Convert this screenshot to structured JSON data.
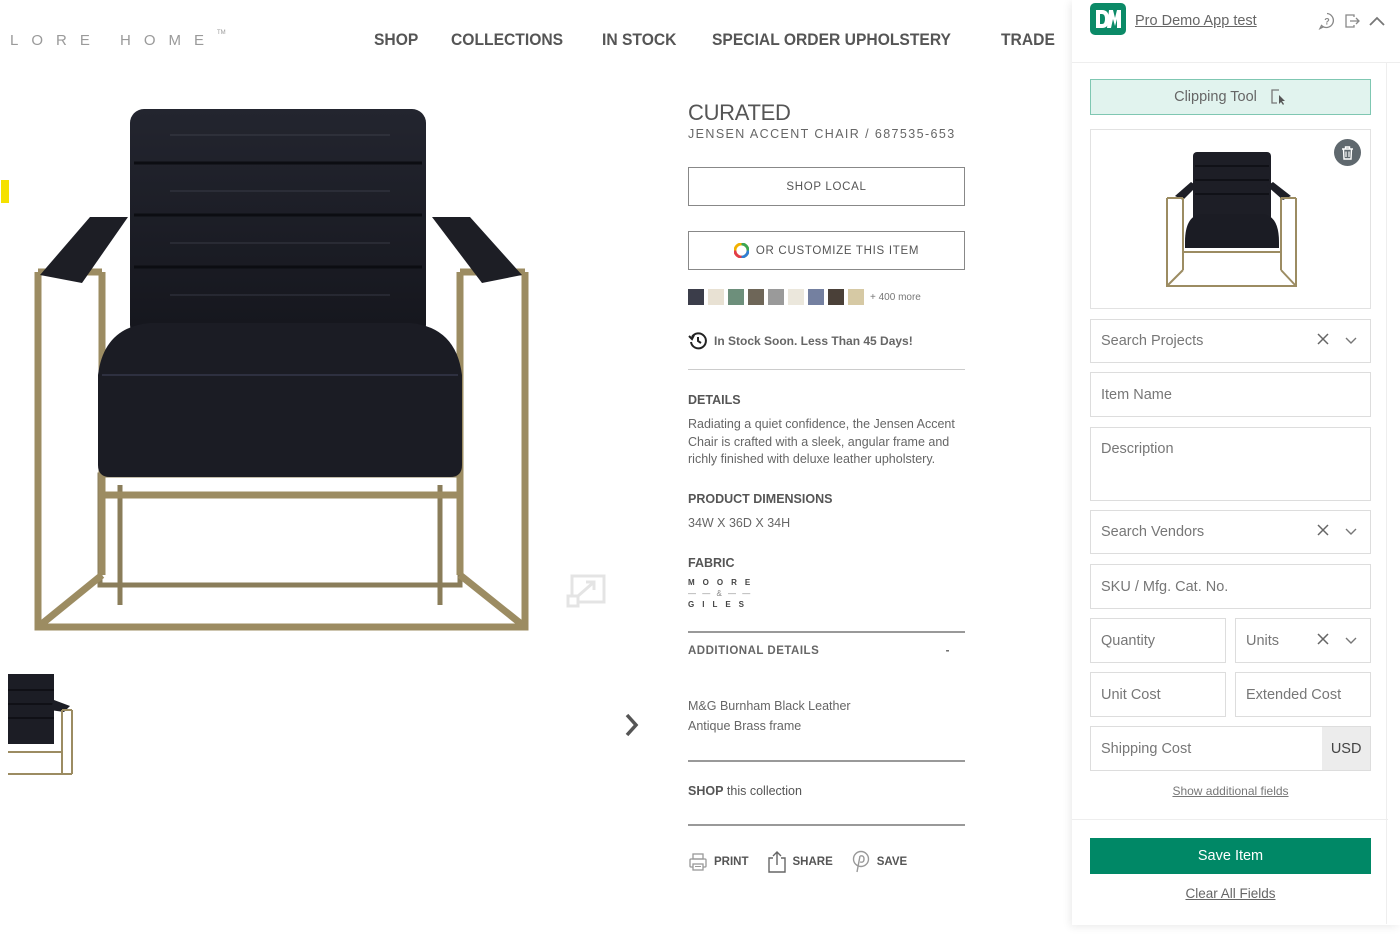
{
  "site": {
    "logo": "LORE HOME",
    "logo_tm": "TM",
    "nav": [
      "SHOP",
      "COLLECTIONS",
      "IN STOCK",
      "SPECIAL ORDER UPHOLSTERY",
      "TRADE"
    ]
  },
  "product": {
    "brand": "CURATED",
    "name_sku": "JENSEN ACCENT CHAIR / 687535-653",
    "shop_local": "SHOP LOCAL",
    "customize": "OR CUSTOMIZE THIS ITEM",
    "swatches": [
      "#3b3d4a",
      "#e8e1d3",
      "#6d8f7b",
      "#6e6658",
      "#9a9a9a",
      "#ebe7dc",
      "#7480a0",
      "#4a4038",
      "#d6c9a4"
    ],
    "swatches_more": "+ 400 more",
    "stock_status": "In Stock Soon. Less Than 45 Days!",
    "details_heading": "DETAILS",
    "details_text": "Radiating a quiet confidence, the Jensen Accent Chair is crafted with a sleek, angular frame and richly finished with deluxe leather upholstery.",
    "dimensions_heading": "PRODUCT DIMENSIONS",
    "dimensions": "34W X 36D X 34H",
    "fabric_heading": "FABRIC",
    "fabric_logo_line1": "MOORE",
    "fabric_logo_line2": "— — & — —",
    "fabric_logo_line3": "GILES",
    "additional_heading": "ADDITIONAL DETAILS",
    "additional_toggle": "-",
    "additional_line1": "M&G Burnham Black Leather",
    "additional_line2": "Antique Brass frame",
    "shop_collection_bold": "SHOP",
    "shop_collection_rest": " this collection",
    "actions": [
      "PRINT",
      "SHARE",
      "SAVE"
    ]
  },
  "panel": {
    "app_name": "Pro Demo App test",
    "clipping_tool": "Clipping Tool",
    "fields": {
      "search_projects": "Search Projects",
      "item_name": "Item Name",
      "description": "Description",
      "search_vendors": "Search Vendors",
      "sku": "SKU / Mfg. Cat. No.",
      "quantity": "Quantity",
      "units": "Units",
      "unit_cost": "Unit Cost",
      "extended_cost": "Extended Cost",
      "shipping_cost": "Shipping Cost",
      "currency": "USD"
    },
    "show_additional": "Show additional fields",
    "save_item": "Save Item",
    "clear_all": "Clear All Fields"
  },
  "colors": {
    "brand_green": "#008866",
    "clip_bg": "#e1f3ee",
    "highlight_yellow": "#f5e100"
  }
}
